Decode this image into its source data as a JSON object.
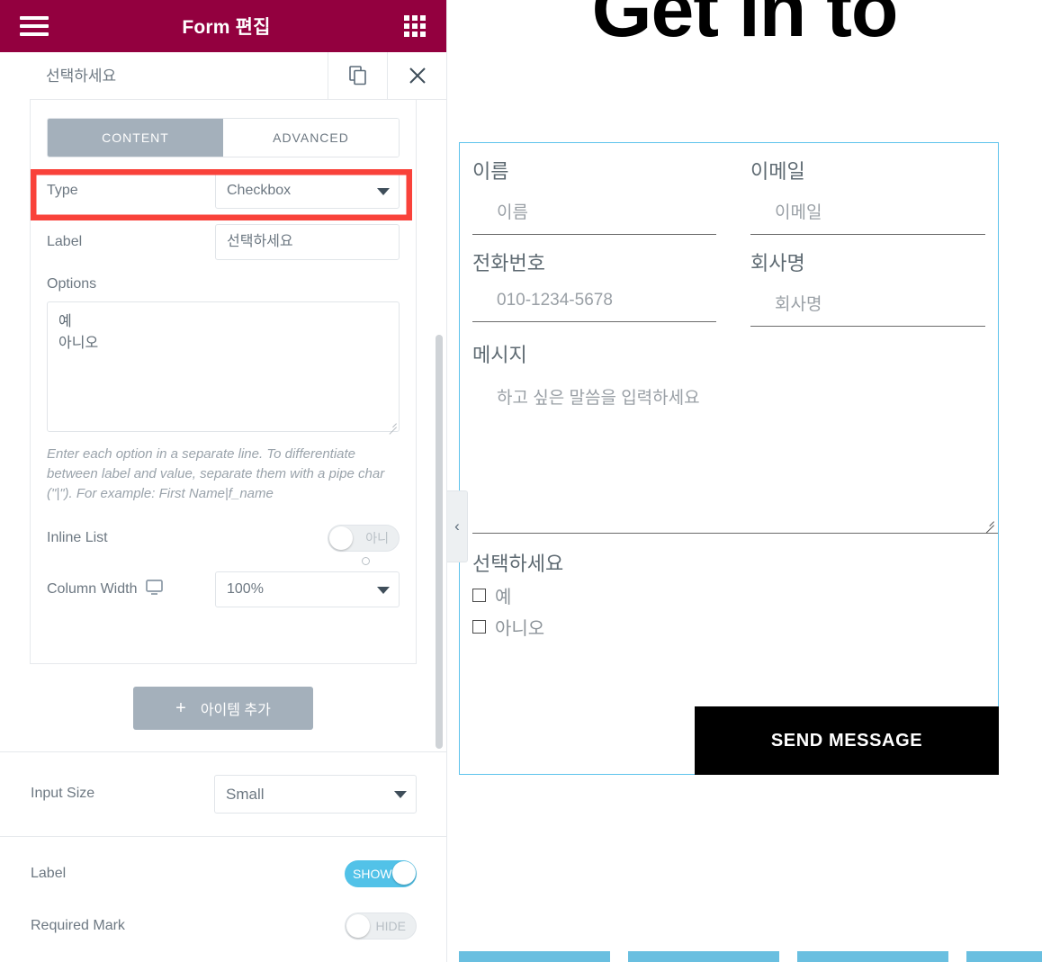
{
  "panel": {
    "header": {
      "title": "Form 편집",
      "menu_icon": "hamburger-icon",
      "apps_icon": "grid-icon"
    },
    "item": {
      "title": "선택하세요",
      "duplicate_icon": "duplicate-icon",
      "close_icon": "close-icon"
    },
    "tabs": [
      {
        "label": "CONTENT",
        "active": true
      },
      {
        "label": "ADVANCED",
        "active": false
      }
    ],
    "fields": {
      "type_label": "Type",
      "type_value": "Checkbox",
      "label_label": "Label",
      "label_value": "선택하세요",
      "options_label": "Options",
      "options_value": "예\n아니오",
      "options_help": "Enter each option in a separate line. To differentiate between label and value, separate them with a pipe char (\"|\"). For example: First Name|f_name",
      "inline_list_label": "Inline List",
      "inline_list_state": "아니",
      "column_width_label": "Column Width",
      "column_width_device_icon": "desktop-icon",
      "column_width_value": "100%",
      "add_item_label": "아이템 추가",
      "add_item_icon": "plus-icon",
      "input_size_label": "Input Size",
      "input_size_value": "Small",
      "show_label_label": "Label",
      "show_label_state": "SHOW",
      "required_mark_label": "Required Mark",
      "required_mark_state": "HIDE"
    },
    "scrollbar": "vertical-scrollbar"
  },
  "collapse_handle": {
    "icon": "chevron-left-icon"
  },
  "preview": {
    "hero_title": "Get in to",
    "fields": [
      {
        "label": "이름",
        "placeholder": "이름"
      },
      {
        "label": "이메일",
        "placeholder": "이메일"
      },
      {
        "label": "전화번호",
        "placeholder": "010-1234-5678"
      },
      {
        "label": "회사명",
        "placeholder": "회사명"
      }
    ],
    "message": {
      "label": "메시지",
      "placeholder": "하고 싶은 말씀을 입력하세요"
    },
    "checkbox_group": {
      "title": "선택하세요",
      "items": [
        "예",
        "아니오"
      ]
    },
    "submit_label": "SEND MESSAGE"
  },
  "colors": {
    "header_maroon": "#93003f",
    "accent_blue": "#5ec3ec",
    "toggle_on": "#52c2e8",
    "highlight_red": "#f9423a",
    "tab_active": "#a4b0bb",
    "bottom_bar": "#69bfe0",
    "submit_bg": "#000000"
  }
}
